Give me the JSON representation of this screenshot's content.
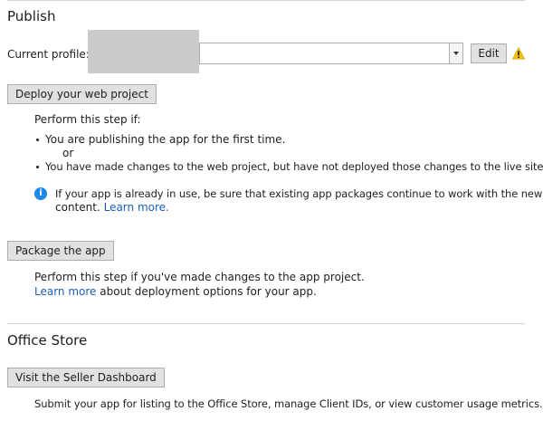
{
  "publish": {
    "title": "Publish",
    "profile_label": "Current profile:",
    "edit_button": "Edit",
    "warning_icon": "warning-icon",
    "deploy_button": "Deploy your web project",
    "deploy_intro": "Perform this step if:",
    "deploy_bullets": [
      "You are publishing the app for the first time.",
      "You have made changes to the web project, but have not deployed those changes to the live site yet."
    ],
    "or_text": "or",
    "info_icon": "info-icon",
    "info_text_line1": "If your app is already in use, be sure that existing app packages continue to work with the new web",
    "info_text_line2_prefix": "content.",
    "info_link": "Learn more.",
    "package_button": "Package the app",
    "package_text": "Perform this step if you've made changes to the app project.",
    "package_link": "Learn more",
    "package_link_suffix": "about deployment options for your app."
  },
  "office_store": {
    "title": "Office Store",
    "seller_button": "Visit the Seller Dashboard",
    "seller_text": "Submit your app for listing to the Office Store, manage Client IDs, or view customer usage metrics."
  }
}
